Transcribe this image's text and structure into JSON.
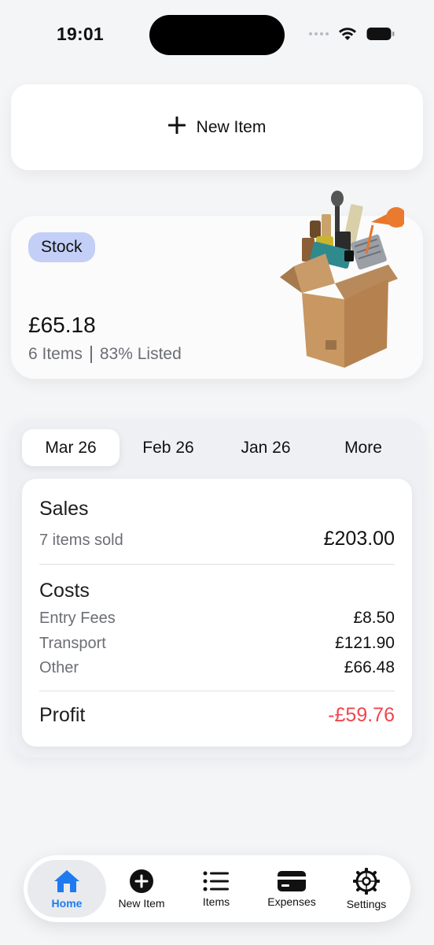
{
  "status_bar": {
    "time": "19:01"
  },
  "new_item_card": {
    "label": "New Item"
  },
  "stock": {
    "badge": "Stock",
    "value": "£65.18",
    "items": "6 Items",
    "listed": "83% Listed"
  },
  "period_tabs": [
    {
      "label": "Mar 26",
      "active": true
    },
    {
      "label": "Feb 26",
      "active": false
    },
    {
      "label": "Jan 26",
      "active": false
    },
    {
      "label": "More",
      "active": false
    }
  ],
  "sales": {
    "title": "Sales",
    "count_label": "7 items sold",
    "total": "£203.00"
  },
  "costs": {
    "title": "Costs",
    "rows": [
      {
        "label": "Entry Fees",
        "value": "£8.50"
      },
      {
        "label": "Transport",
        "value": "£121.90"
      },
      {
        "label": "Other",
        "value": "£66.48"
      }
    ]
  },
  "profit": {
    "label": "Profit",
    "value": "-£59.76",
    "color": "#f0454e"
  },
  "tab_bar": {
    "items": [
      {
        "label": "Home",
        "icon": "home-icon",
        "active": true
      },
      {
        "label": "New Item",
        "icon": "plus-circle-icon",
        "active": false
      },
      {
        "label": "Items",
        "icon": "list-icon",
        "active": false
      },
      {
        "label": "Expenses",
        "icon": "card-icon",
        "active": false
      },
      {
        "label": "Settings",
        "icon": "gear-icon",
        "active": false
      }
    ],
    "active_color": "#1f7aef"
  }
}
